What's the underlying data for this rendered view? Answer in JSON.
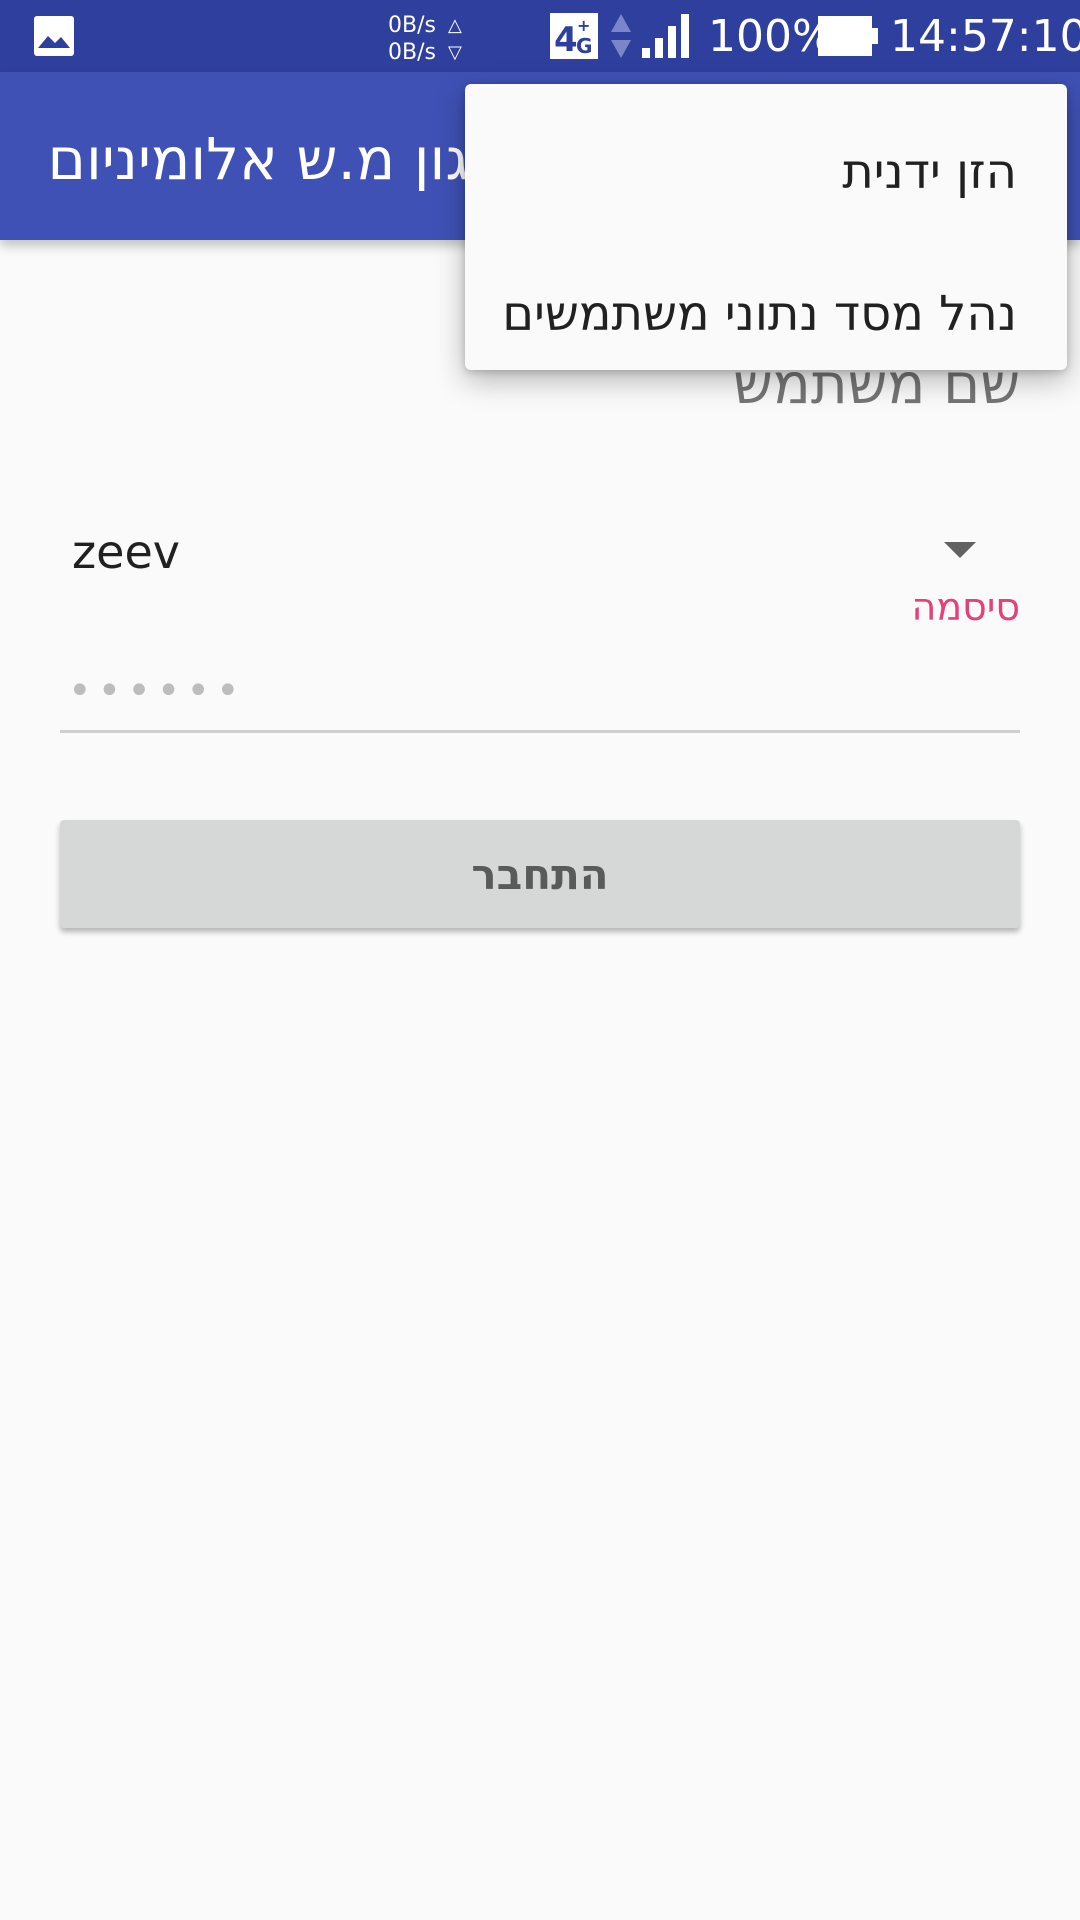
{
  "status_bar": {
    "image_icon": "image-icon",
    "upload_speed": "0B/s",
    "upload_arrow": "△",
    "download_speed": "0B/s",
    "download_arrow": "▽",
    "network_type": "4G",
    "battery_percent": "100%",
    "time": "14:57:10",
    "signal_icon": "signal-icon",
    "battery_icon": "battery-icon",
    "colors": {
      "background": "#2f3f9e",
      "foreground": "#ffffff"
    }
  },
  "app_bar": {
    "title": "אגון מ.ש אלומיניום",
    "colors": {
      "background": "#3f51b5",
      "foreground": "#ffffff"
    }
  },
  "overflow_menu": {
    "items": [
      {
        "label": "הזן ידנית"
      },
      {
        "label": "נהל מסד נתוני משתמשים"
      }
    ]
  },
  "form": {
    "username_label": "שם משתמש",
    "username_value": "zeev",
    "password_label": "סיסמה",
    "password_masked": "••••••",
    "login_button": "התחבר",
    "colors": {
      "accent": "#e4407a",
      "button_bg": "#d6d7d7"
    }
  }
}
